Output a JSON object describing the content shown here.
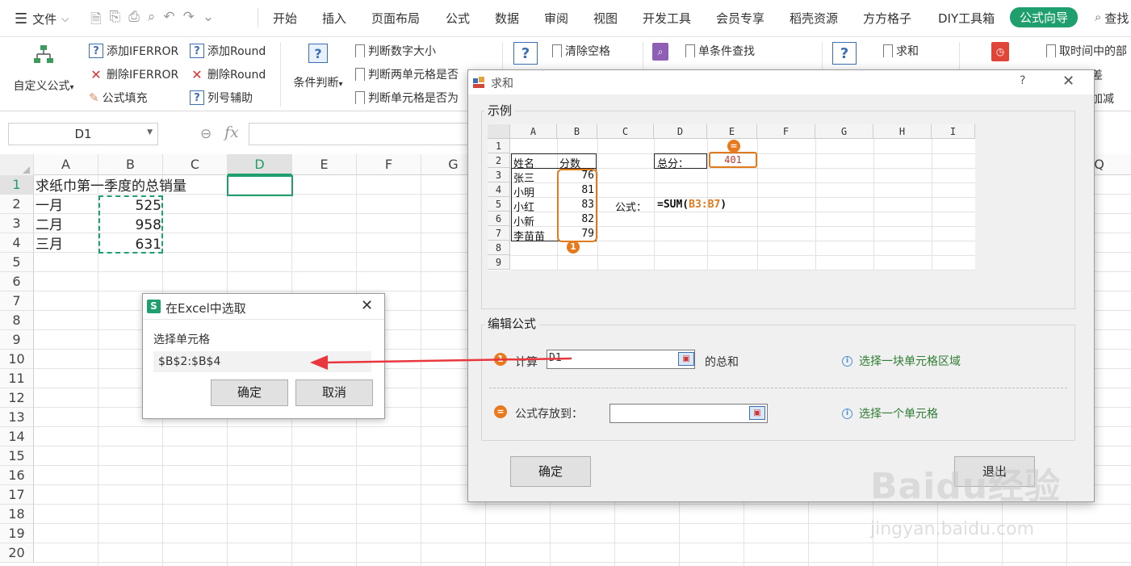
{
  "menubar": {
    "file_label": "文件",
    "tabs": [
      "开始",
      "插入",
      "页面布局",
      "公式",
      "数据",
      "审阅",
      "视图",
      "开发工具",
      "会员专享",
      "稻壳资源",
      "方方格子",
      "DIY工具箱",
      "公式向导"
    ],
    "active_tab": "公式向导",
    "search_label": "查找"
  },
  "ribbon": {
    "custom_formula": "自定义公式",
    "add_iferror": "添加IFERROR",
    "del_iferror": "删除IFERROR",
    "formula_fill": "公式填充",
    "add_round": "添加Round",
    "del_round": "删除Round",
    "col_helper": "列号辅助",
    "cond_judge": "条件判断",
    "judge_num_size": "判断数字大小",
    "judge_two_cells": "判断两单元格是否",
    "judge_cell_is": "判断单元格是否为",
    "clear_space": "清除空格",
    "single_lookup": "单条件查找",
    "sum": "求和",
    "get_time": "取时间中的部",
    "diff": "差",
    "add_sub": "加减"
  },
  "namebox": {
    "value": "D1"
  },
  "fx_label": "fx",
  "sheet": {
    "columns": [
      "A",
      "B",
      "C",
      "D",
      "E",
      "F",
      "G",
      "Q"
    ],
    "rows": [
      "1",
      "2",
      "3",
      "4",
      "5",
      "6",
      "7",
      "8",
      "9",
      "10",
      "11",
      "12",
      "13",
      "14",
      "15",
      "16",
      "17",
      "18",
      "19",
      "20"
    ],
    "title": "求纸巾第一季度的总销量",
    "months": [
      "一月",
      "二月",
      "三月"
    ],
    "values": [
      "525",
      "958",
      "631"
    ]
  },
  "select_dialog": {
    "title": "在Excel中选取",
    "prompt": "选择单元格",
    "value": "$B$2:$B$4",
    "ok": "确定",
    "cancel": "取消"
  },
  "sum_dialog": {
    "title": "求和",
    "help": "?",
    "example_group": "示例",
    "edit_group": "编辑公式",
    "example": {
      "cols": [
        "A",
        "B",
        "C",
        "D",
        "E",
        "F",
        "G",
        "H",
        "I"
      ],
      "rows": [
        "1",
        "2",
        "3",
        "4",
        "5",
        "6",
        "7",
        "8",
        "9"
      ],
      "name_header": "姓名",
      "score_header": "分数",
      "names": [
        "张三",
        "小明",
        "小红",
        "小新",
        "李苗苗"
      ],
      "scores": [
        "76",
        "81",
        "83",
        "82",
        "79"
      ],
      "total_label": "总分：",
      "total_value": "401",
      "formula_label": "公式：",
      "formula_prefix": "=SUM(",
      "formula_range": "B3:B7",
      "formula_suffix": ")"
    },
    "calc_label": "计算",
    "calc_value": "D1",
    "sum_suffix": "的总和",
    "hint_range": "选择一块单元格区域",
    "store_label": "公式存放到：",
    "hint_cell": "选择一个单元格",
    "ok": "确定",
    "exit": "退出"
  },
  "watermark": {
    "line1": "Baidu经验",
    "line2": "jingyan.baidu.com"
  },
  "colors": {
    "accent": "#1f9f6d",
    "orange": "#e87a1d",
    "arrow": "#e8383d",
    "hint_green": "#2e7d32"
  }
}
